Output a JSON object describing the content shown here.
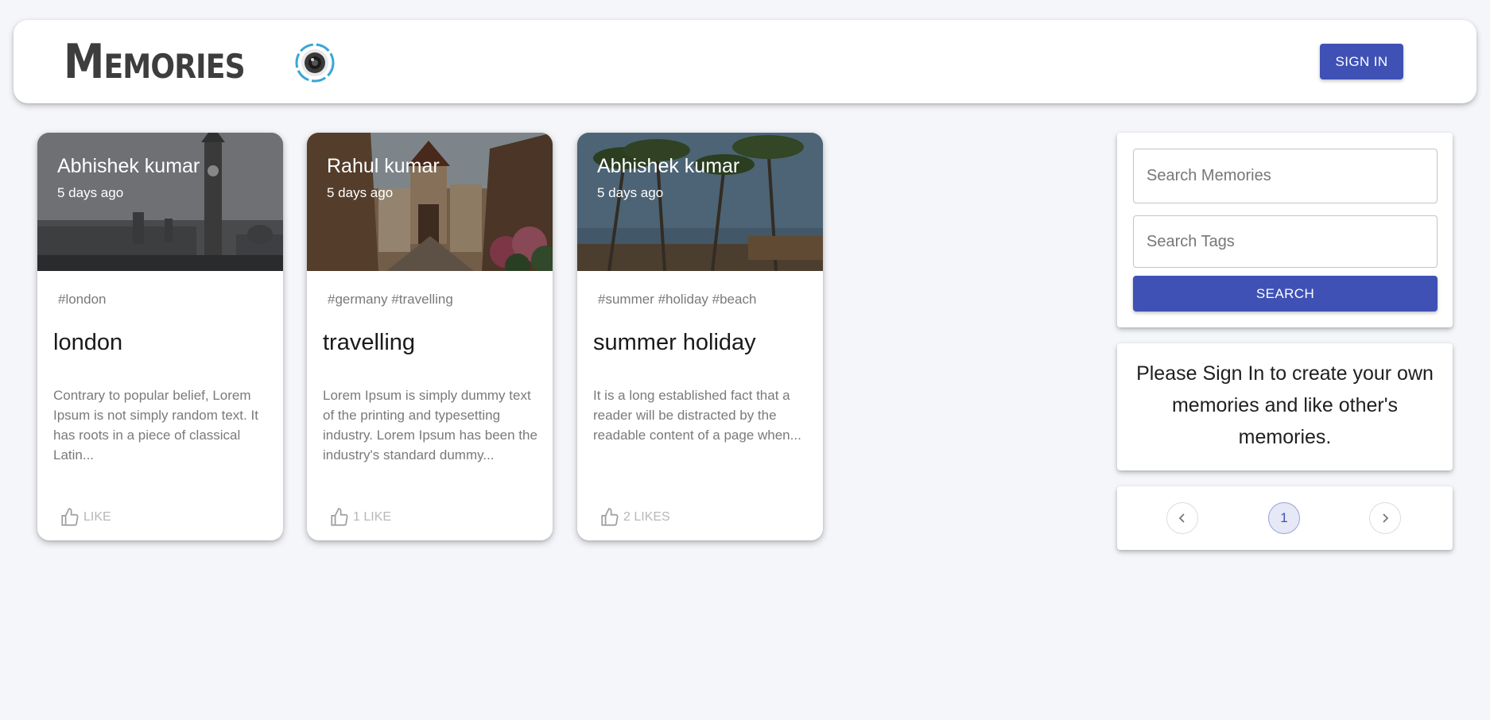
{
  "header": {
    "brand_title": "Memories",
    "logo_icon": "camera-lens-icon",
    "signin_label": "SIGN IN",
    "accent": "#3f51b5"
  },
  "posts": [
    {
      "author": "Abhishek kumar",
      "time": "5 days ago",
      "tags": "#london",
      "title": "london",
      "excerpt": "Contrary to popular belief, Lorem Ipsum is not simply random text. It has roots in a piece of classical Latin...",
      "like_label": "LIKE",
      "image_subject": "london-big-ben"
    },
    {
      "author": "Rahul kumar",
      "time": "5 days ago",
      "tags": "#germany #travelling",
      "title": "travelling",
      "excerpt": "Lorem Ipsum is simply dummy text of the printing and typesetting industry. Lorem Ipsum has been the industry's standard dummy...",
      "like_label": "1 LIKE",
      "image_subject": "german-old-town-street"
    },
    {
      "author": "Abhishek kumar",
      "time": "5 days ago",
      "tags": "#summer #holiday #beach",
      "title": "summer holiday",
      "excerpt": "It is a long established fact that a reader will be distracted by the readable content of a page when...",
      "like_label": "2 LIKES",
      "image_subject": "palm-trees-beach"
    }
  ],
  "search": {
    "memories_placeholder": "Search Memories",
    "tags_placeholder": "Search Tags",
    "button_label": "SEARCH"
  },
  "signin_message": "Please Sign In to create your own memories and like other's memories.",
  "pagination": {
    "current_page": "1",
    "prev_icon": "chevron-left-icon",
    "next_icon": "chevron-right-icon"
  }
}
